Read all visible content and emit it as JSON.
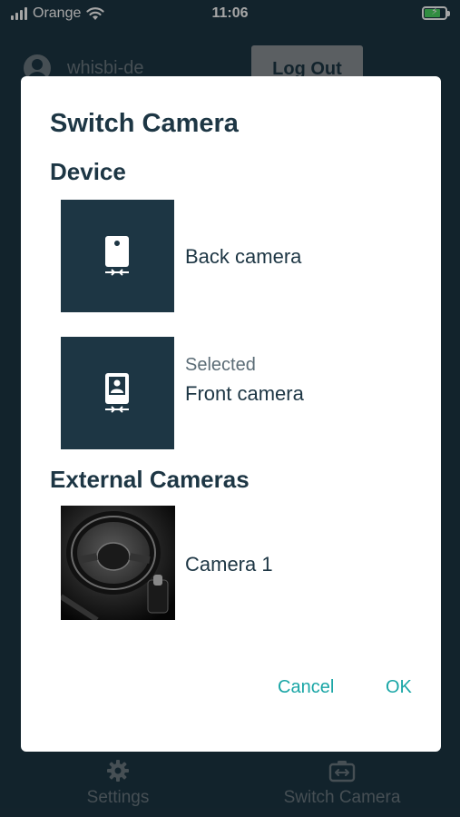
{
  "status_bar": {
    "carrier": "Orange",
    "time": "11:06"
  },
  "app_header": {
    "username": "whisbi-de",
    "logout_label": "Log Out"
  },
  "dialog": {
    "title": "Switch Camera",
    "device_section": "Device",
    "back_camera": {
      "label": "Back camera"
    },
    "front_camera": {
      "status": "Selected",
      "label": "Front camera"
    },
    "external_section": "External Cameras",
    "external_cameras": [
      {
        "label": "Camera 1"
      }
    ],
    "cancel_label": "Cancel",
    "ok_label": "OK"
  },
  "tab_bar": {
    "settings_label": "Settings",
    "switch_camera_label": "Switch Camera"
  },
  "colors": {
    "primary_dark": "#1d3644",
    "accent": "#1aa6a6",
    "background": "#ffffff"
  }
}
